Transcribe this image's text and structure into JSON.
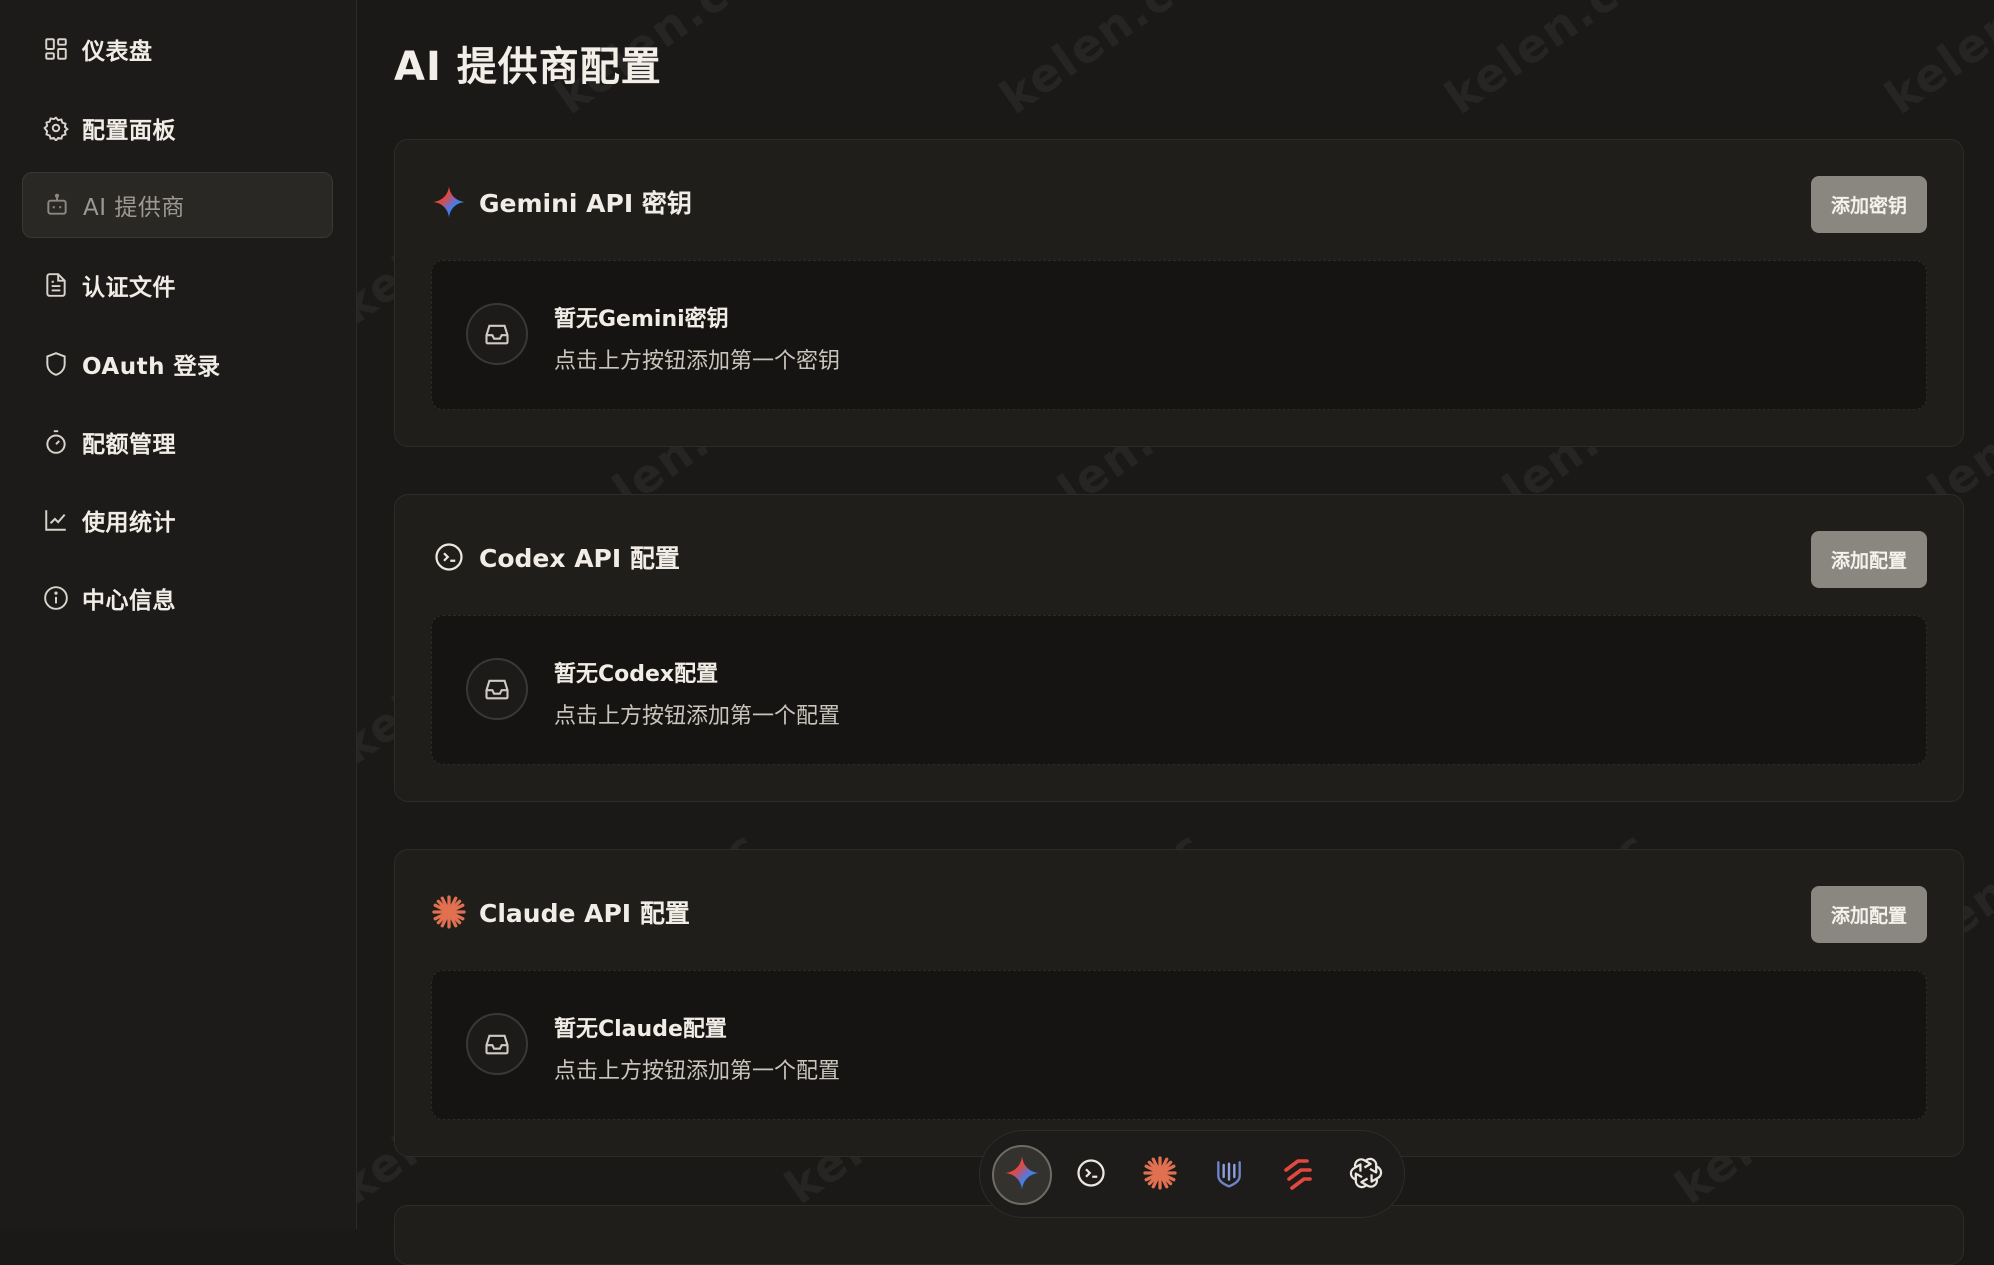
{
  "sidebar": {
    "items": [
      {
        "label": "仪表盘",
        "icon": "dashboard-icon"
      },
      {
        "label": "配置面板",
        "icon": "gear-icon"
      },
      {
        "label": "AI 提供商",
        "icon": "bot-icon",
        "active": true
      },
      {
        "label": "认证文件",
        "icon": "file-icon"
      },
      {
        "label": "OAuth 登录",
        "icon": "shield-icon"
      },
      {
        "label": "配额管理",
        "icon": "timer-icon"
      },
      {
        "label": "使用统计",
        "icon": "chart-icon"
      },
      {
        "label": "中心信息",
        "icon": "info-icon"
      }
    ]
  },
  "main": {
    "title": "AI 提供商配置",
    "cards": [
      {
        "title": "Gemini API 密钥",
        "icon": "gemini-icon",
        "button": "添加密钥",
        "empty_title": "暂无Gemini密钥",
        "empty_desc": "点击上方按钮添加第一个密钥"
      },
      {
        "title": "Codex API 配置",
        "icon": "codex-icon",
        "button": "添加配置",
        "empty_title": "暂无Codex配置",
        "empty_desc": "点击上方按钮添加第一个配置"
      },
      {
        "title": "Claude API 配置",
        "icon": "claude-icon",
        "button": "添加配置",
        "empty_title": "暂无Claude配置",
        "empty_desc": "点击上方按钮添加第一个配置"
      }
    ]
  },
  "quick_nav": {
    "items": [
      "gemini-icon",
      "codex-icon",
      "claude-icon",
      "shield-bars-icon",
      "arrows-icon",
      "openai-icon"
    ],
    "active": "gemini-icon"
  },
  "watermark": "kelen.cc",
  "colors": {
    "background": "#1a1917",
    "sidebar": "#1c1b19",
    "card": "#1f1e1b",
    "button": "#8a8680",
    "claude": "#e0704f",
    "openai_red": "#e2483d"
  }
}
